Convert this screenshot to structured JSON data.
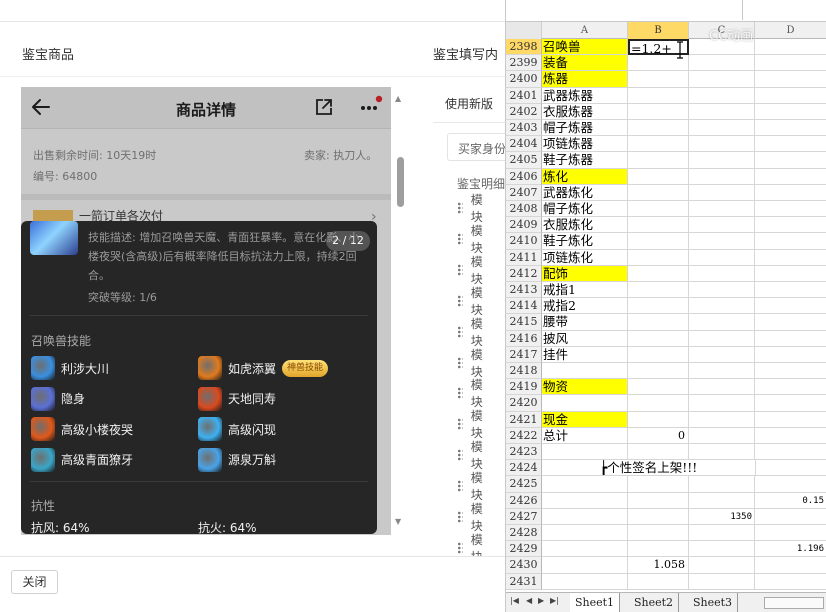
{
  "left_app": {
    "header_left": "鉴宝商品",
    "header_right": "鉴宝填写内",
    "use_new_version": "使用新版",
    "buyer_box": "买家身份",
    "appraisal_label": "鉴宝明细",
    "module_label": "模块",
    "module_count": 12,
    "close_button": "关闭"
  },
  "phone": {
    "nav_title": "商品详情",
    "sale_remaining": "出售剩余时间: 10天19时",
    "seller": "卖家: 执刀人。",
    "serial": "编号: 64800",
    "bg_item_text": "一箭订单各次付",
    "bg_chevron": "›"
  },
  "popup": {
    "counter": "2 / 12",
    "skill_desc": "技能描述: 增加召唤兽天魔、青面狂暴率。意在化影、小楼夜哭(含高级)后有概率降低目标抗法力上限，持续2回合。",
    "break_level": "突破等级: 1/6",
    "skills_title": "召唤兽技能",
    "skills": [
      {
        "name": "利涉大川",
        "icon": "water-wave-icon",
        "color": "#3a8fe0"
      },
      {
        "name": "如虎添翼",
        "icon": "tiger-wing-icon",
        "color": "#e07a1e",
        "badge": "神兽技能"
      },
      {
        "name": "隐身",
        "icon": "invisibility-icon",
        "color": "#5b6fd6"
      },
      {
        "name": "天地同寿",
        "icon": "sky-earth-icon",
        "color": "#d94a1f"
      },
      {
        "name": "高级小楼夜哭",
        "icon": "night-tower-icon",
        "color": "#e0581a"
      },
      {
        "name": "高级闪现",
        "icon": "flash-icon",
        "color": "#3fb0f0"
      },
      {
        "name": "高级青面獠牙",
        "icon": "green-fang-icon",
        "color": "#3aa6c8"
      },
      {
        "name": "源泉万斛",
        "icon": "spring-icon",
        "color": "#4aa3e8"
      }
    ],
    "resist_title": "抗性",
    "resists": [
      {
        "label": "抗风: 64%"
      },
      {
        "label": "抗火: 64%"
      }
    ]
  },
  "spreadsheet": {
    "col_headers": [
      "A",
      "B",
      "C",
      "D"
    ],
    "selected_col": "B",
    "watermark": "CC动画",
    "active_formula": "=1.2+",
    "rows": [
      {
        "n": "2398",
        "a": "召唤兽",
        "hl": true,
        "b": "=1.2+",
        "active": true
      },
      {
        "n": "2399",
        "a": "装备",
        "hl": true
      },
      {
        "n": "2400",
        "a": "炼器",
        "hl": true
      },
      {
        "n": "2401",
        "a": "武器炼器"
      },
      {
        "n": "2402",
        "a": "衣服炼器"
      },
      {
        "n": "2403",
        "a": "帽子炼器"
      },
      {
        "n": "2404",
        "a": "项链炼器"
      },
      {
        "n": "2405",
        "a": "鞋子炼器"
      },
      {
        "n": "2406",
        "a": "炼化",
        "hl": true
      },
      {
        "n": "2407",
        "a": "武器炼化"
      },
      {
        "n": "2408",
        "a": "帽子炼化"
      },
      {
        "n": "2409",
        "a": "衣服炼化"
      },
      {
        "n": "2410",
        "a": "鞋子炼化"
      },
      {
        "n": "2411",
        "a": "项链炼化"
      },
      {
        "n": "2412",
        "a": "配饰",
        "hl": true
      },
      {
        "n": "2413",
        "a": "戒指1"
      },
      {
        "n": "2414",
        "a": "戒指2"
      },
      {
        "n": "2415",
        "a": "腰带"
      },
      {
        "n": "2416",
        "a": "披风"
      },
      {
        "n": "2417",
        "a": "挂件"
      },
      {
        "n": "2418",
        "a": ""
      },
      {
        "n": "2419",
        "a": "物资",
        "hl": true
      },
      {
        "n": "2420",
        "a": ""
      },
      {
        "n": "2421",
        "a": "现金",
        "hl": true
      },
      {
        "n": "2422",
        "a": "总计",
        "b": "0"
      },
      {
        "n": "2423",
        "a": ""
      },
      {
        "n": "2424",
        "merged": "┢个性签名上架!!!"
      },
      {
        "n": "2425",
        "a": ""
      },
      {
        "n": "2426",
        "a": "",
        "d": "0.15"
      },
      {
        "n": "2427",
        "a": "",
        "c": "1350"
      },
      {
        "n": "2428",
        "a": ""
      },
      {
        "n": "2429",
        "a": "",
        "d": "1.196"
      },
      {
        "n": "2430",
        "a": "",
        "b": "1.058"
      },
      {
        "n": "2431",
        "a": ""
      }
    ],
    "tabs": [
      "Sheet1",
      "Sheet2",
      "Sheet3"
    ],
    "active_tab": "Sheet1"
  }
}
